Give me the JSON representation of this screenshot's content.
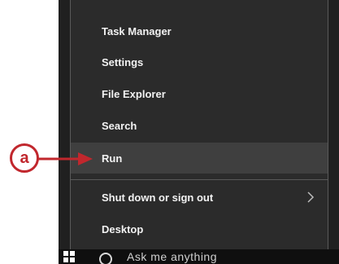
{
  "menu": {
    "items": [
      {
        "label": "Task Manager"
      },
      {
        "label": "Settings"
      },
      {
        "label": "File Explorer"
      },
      {
        "label": "Search"
      },
      {
        "label": "Run"
      },
      {
        "label": "Shut down or sign out"
      },
      {
        "label": "Desktop"
      }
    ]
  },
  "taskbar": {
    "search_text": "Ask me anything"
  },
  "callout": {
    "label": "a",
    "color": "#c1272d"
  }
}
